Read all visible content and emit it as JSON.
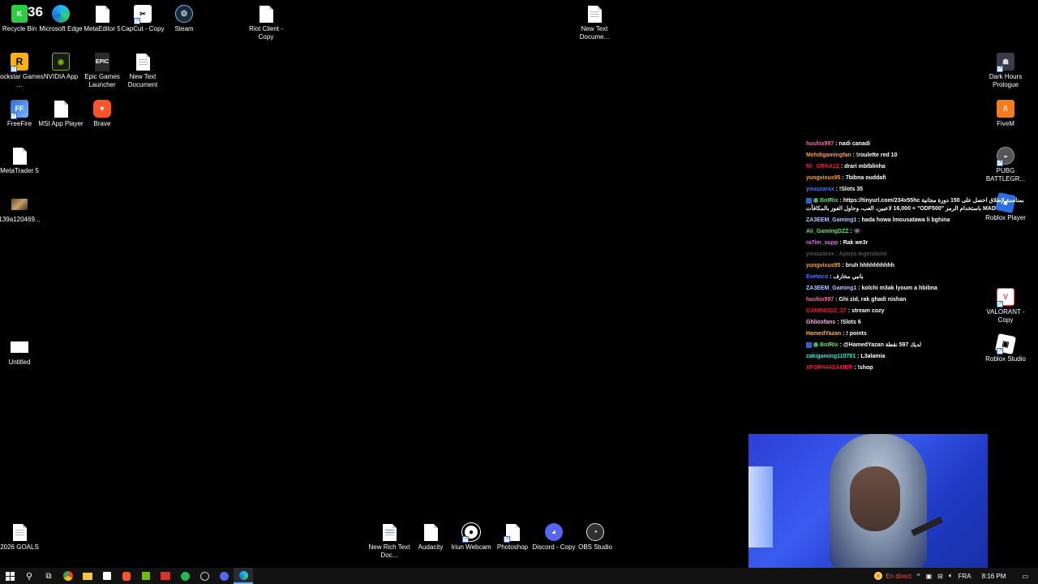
{
  "desktop": {
    "icons": {
      "recycle_bin": "Recycle Bin",
      "edge": "Microsoft Edge",
      "metaeditor": "MetaEditor 5",
      "capcut": "CapCut - Copy",
      "steam": "Steam",
      "riot": "Riot Client - Copy",
      "newtext_top": "New Text Docume...",
      "rockstar": "Rockstar Games ...",
      "nvidia": "NVIDIA App",
      "epic": "Epic Games Launcher",
      "newtext2": "New Text Document",
      "darkhours": "Dark Hours Prologue",
      "freefire": "FreeFire",
      "msi": "MSI App Player",
      "brave": "Brave",
      "fivem": "FiveM",
      "metatrader": "MetaTrader 5",
      "pubg": "PUBG BATTLEGR...",
      "img139": "139a120469...",
      "roblox_player": "Roblox Player",
      "valorant": "VALORANT - Copy",
      "untitled": "Untitled",
      "roblox_studio": "Roblox Studio",
      "goals": "2026 GOALS",
      "newrich": "New Rich Text Doc...",
      "audacity": "Audacity",
      "iriun": "Iriun Webcam",
      "photoshop": "Photoshop",
      "discord": "Discord - Copy",
      "obs": "OBS Studio"
    },
    "recycle_overlay": "36"
  },
  "chat": [
    {
      "user": "hushix997",
      "text": ": nadi canadi",
      "color": "#ff69b4"
    },
    {
      "user": "Mehdigamingfan",
      "text": ": !roulette red 10",
      "color": "#ff9f3d"
    },
    {
      "user": "Mr_ORKA12",
      "text": ": drari mblblinha",
      "color": "#e0243b"
    },
    {
      "user": "yungvixus95",
      "text": ": 7bibna ouddafi",
      "color": "#ffa500"
    },
    {
      "user": "youuzarxx",
      "text": ": !Slots 35",
      "color": "#4a78ff"
    },
    {
      "user": "BotRix",
      "text": ": https://tinyurl.com/234x55hc بمناسبة لإطلاق احصل على 150 دورة مجانية + 16,000 لاعبين، العب، وحاول الفوز بالمكافآت \"ODF500\" باستخدام الرمز MAD",
      "color": "#6ee05a",
      "mod": true
    },
    {
      "user": "ZA3EEM_Gaming1",
      "text": ": hada howa lmousatawa li bghina",
      "color": "#b8c8ff"
    },
    {
      "user": "Ali_GamingDZZ",
      "text": ": 👾",
      "color": "#6ee05a"
    },
    {
      "user": "ra7im_supp",
      "text": ": Rak we3r",
      "color": "#e06cf0"
    },
    {
      "user": "youuzarxx",
      "text": ": Apoyo legendario",
      "color": "#555555",
      "dim": true
    },
    {
      "user": "yungvixus95",
      "text": ": bruh hhhhhhhhhh",
      "color": "#ffa500"
    },
    {
      "user": "Evetoco",
      "text": ": يانبي مخارف",
      "color": "#4a78ff"
    },
    {
      "user": "ZA3EEM_Gaming1",
      "text": ": kolchi m3ak lyoum a hbibna",
      "color": "#b8c8ff"
    },
    {
      "user": "hushix997",
      "text": ": Ghi zid, rak ghadi nishan",
      "color": "#ff69b4"
    },
    {
      "user": "GAMINGDZ_27",
      "text": ": stream cozy",
      "color": "#e0243b"
    },
    {
      "user": "Ghlioxfans",
      "text": ": !Slots 6",
      "color": "#ffb0e8"
    },
    {
      "user": "HamedYazan",
      "text": ": ! points",
      "color": "#ffb347"
    },
    {
      "user": "BotRix",
      "text": ": @HamedYazan لديك 597 نقطة",
      "color": "#6ee05a",
      "mod": true
    },
    {
      "user": "zakigaming110781",
      "text": ": L3alamia",
      "color": "#40e0d0"
    },
    {
      "user": "XFOR444GAMER",
      "text": ": !shop",
      "color": "#e0243b"
    }
  ],
  "taskbar": {
    "live_label": "En direct",
    "lang": "FRA",
    "time": "8:16 PM"
  }
}
